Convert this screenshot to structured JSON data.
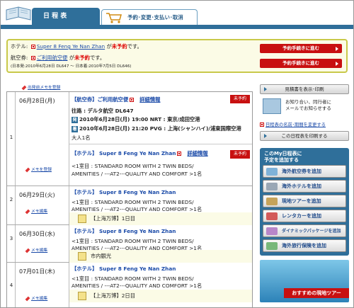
{
  "header": {
    "tab_active": "日 程 表",
    "tab_other": "予約･変更･支払い･取消"
  },
  "status": {
    "hotel_label": "ホテル:",
    "hotel_name": "Super 8 Feng Ye Nan Zhan",
    "hotel_ga": "が",
    "hotel_state": "未予約",
    "hotel_desu": "です。",
    "air_label": "航空券:",
    "air_name": "ご利用航空便",
    "air_ga": "が",
    "air_state": "未予約",
    "air_desu": "です。",
    "air_sub": "(日本発:2010年6月28日 DL647 ～ 日本着:2010年7月5日 DL646)",
    "reserve_button_1": "予約手続きに進む",
    "reserve_button_2": "予約手続きに進む"
  },
  "memo_top": "出発前メモを登録",
  "schedule": [
    {
      "day": "1",
      "date": "06月28日(月)",
      "memo": "メモを登録",
      "flight_title": "【航空券】ご利用航空便",
      "flight_detail": "詳細情報",
      "flight_badge": "未予約",
      "flight_out": "往路 : デルタ航空 DL647",
      "flight_dep": "2010年6月28日(月) 19:00 NRT : 東京/成田空港",
      "flight_arr": "2010年6月28日(月) 21:20 PVG : 上海(シャンハイ)/浦東国際空港",
      "flight_pax": "大人1名",
      "dep_icon": "発",
      "arr_icon": "着",
      "hotel_title": "【ホテル】 Super 8 Feng Ye Nan Zhan",
      "hotel_detail": "詳細情報",
      "hotel_badge": "未予約",
      "hotel_room_1": "<1室目 : STANDARD ROOM WITH 2 TWIN BEDS/",
      "hotel_room_2": "AMENITIES / ---AT2---QUALITY AND COMFORT >1名"
    },
    {
      "day": "2",
      "date": "06月29日(火)",
      "memo": "メモ編集",
      "hotel_title": "【ホテル】 Super 8 Feng Ye Nan Zhan",
      "hotel_room_1": "<1室目 : STANDARD ROOM WITH 2 TWIN BEDS/",
      "hotel_room_2": "AMENITIES / ---AT2---QUALITY AND COMFORT >1名",
      "note": "【上海万博】1日目"
    },
    {
      "day": "3",
      "date": "06月30日(水)",
      "memo": "メモ編集",
      "hotel_title": "【ホテル】 Super 8 Feng Ye Nan Zhan",
      "hotel_room_1": "<1室目 : STANDARD ROOM WITH 2 TWIN BEDS/",
      "hotel_room_2": "AMENITIES / ---AT2---QUALITY AND COMFORT >1名",
      "note": "市内観光"
    },
    {
      "day": "4",
      "date": "07月01日(木)",
      "memo": "メモ編集",
      "hotel_title": "【ホテル】 Super 8 Feng Ye Nan Zhan",
      "hotel_room_1": "<1室目 : STANDARD ROOM WITH 2 TWIN BEDS/",
      "hotel_room_2": "AMENITIES / ---AT2---QUALITY AND COMFORT >1名",
      "note": "【上海万博】2日目"
    }
  ],
  "sidebar": {
    "print_estimate": "見積書を表示･印刷",
    "notify_1": "お知り合い、同行者に",
    "notify_2": "メールでお知らせする",
    "rename_link": "日程表の名前･期間を変更する",
    "print_schedule": "この日程表を印刷する",
    "add_head_1": "このMy日程表に",
    "add_head_2": "予定を追加する",
    "add_air": "海外航空券を追加",
    "add_hotel": "海外ホテルを追加",
    "add_tour": "現地ツアーを追加",
    "add_car": "レンタカーを追加",
    "add_package": "ダイナミックパッケージを追加",
    "add_insurance": "海外旅行保険を追加",
    "banner": "おすすめの現地ツアー"
  }
}
